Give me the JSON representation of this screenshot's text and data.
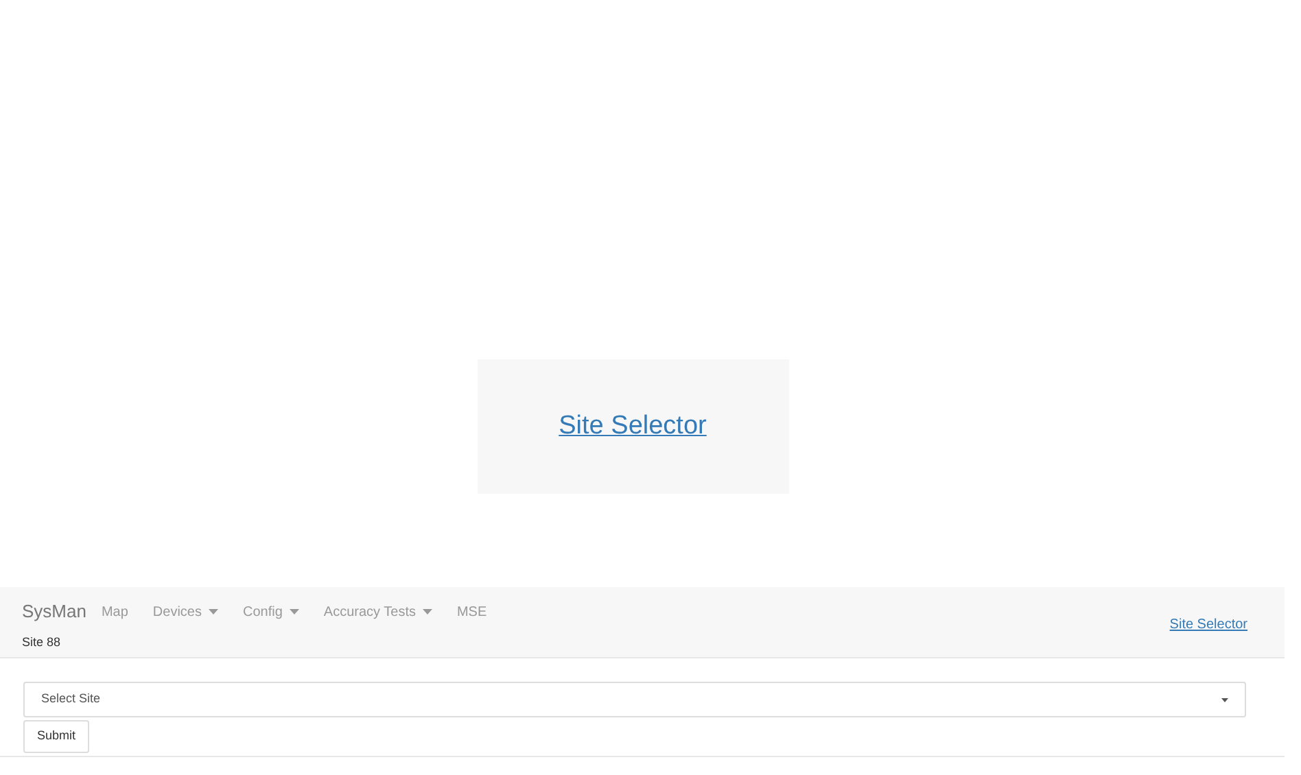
{
  "hero": {
    "link": "Site Selector"
  },
  "navbar": {
    "brand": "SysMan",
    "items": [
      {
        "label": "Map",
        "dropdown": false
      },
      {
        "label": "Devices",
        "dropdown": true
      },
      {
        "label": "Config",
        "dropdown": true
      },
      {
        "label": "Accuracy Tests",
        "dropdown": true
      },
      {
        "label": "MSE",
        "dropdown": false
      }
    ],
    "subtitle": "Site 88",
    "right_link": "Site Selector"
  },
  "form": {
    "select": {
      "value": "Select Site"
    },
    "submit": "Submit"
  }
}
